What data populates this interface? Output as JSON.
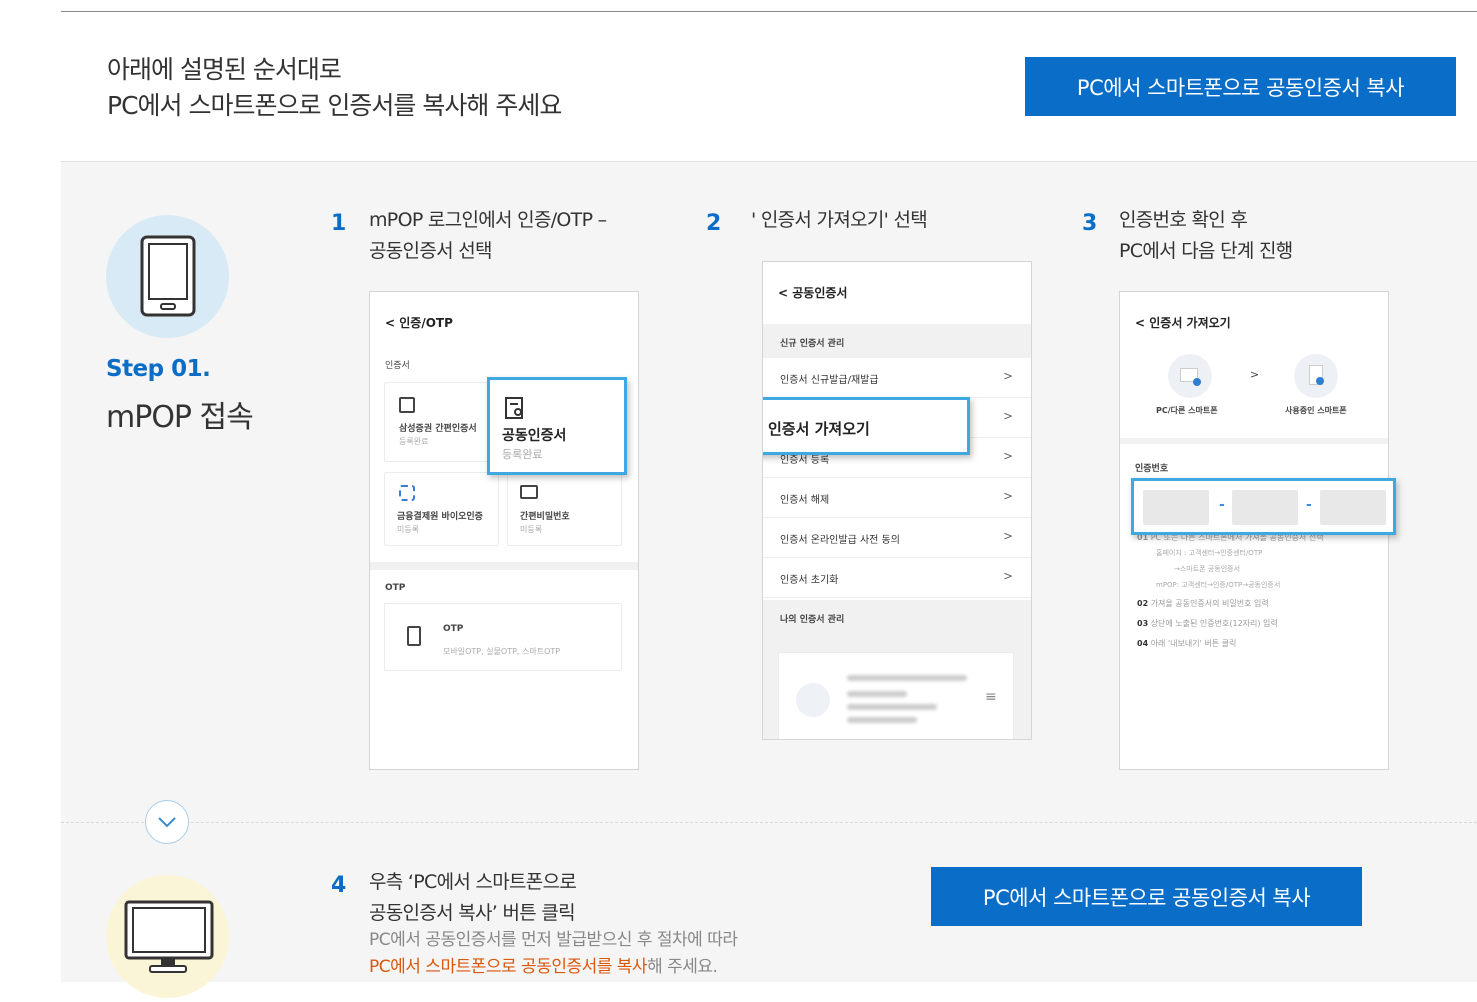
{
  "intro": {
    "line1": "아래에 설명된 순서대로",
    "line2": "PC에서 스마트폰으로 인증서를 복사해 주세요"
  },
  "top_button": "PC에서 스마트폰으로 공동인증서 복사",
  "step1": {
    "label": "Step 01.",
    "title": "mPOP 접속",
    "icon": "smartphone-icon",
    "items": [
      {
        "num": "1",
        "line1": "mPOP 로그인에서 인증/OTP –",
        "line2": "공동인증서 선택"
      },
      {
        "num": "2",
        "line1": "' 인증서 가져오기' 선택"
      },
      {
        "num": "3",
        "line1": "인증번호 확인 후",
        "line2": "PC에서 다음 단계 진행"
      }
    ]
  },
  "screen1": {
    "back": "< 인증/OTP",
    "section": "인증서",
    "card1_title": "삼성증권 간편인증서",
    "card1_sub": "등록완료",
    "popup_title": "공동인증서",
    "popup_sub": "등록완료",
    "card3_title": "금융결제원 바이오인증",
    "card3_sub": "미등록",
    "card4_title": "간편비밀번호",
    "card4_sub": "미등록",
    "otp_section": "OTP",
    "otp_title": "OTP",
    "otp_sub": "모바일OTP, 실물OTP, 스마트OTP"
  },
  "screen2": {
    "back": "< 공동인증서",
    "section1": "신규 인증서 관리",
    "rows": [
      "인증서 신규발급/재발급",
      "",
      "인증서 등록",
      "인증서 해제",
      "인증서 온라인발급 사전 동의",
      "인증서 초기화"
    ],
    "arrow": ">",
    "section2": "나의 인증서 관리",
    "popup": "인증서 가져오기"
  },
  "screen3": {
    "back": "< 인증서 가져오기",
    "from_label": "PC/다른 스마트폰",
    "to_label": "사용중인 스마트폰",
    "arrow": ">",
    "code_label": "인증번호",
    "dash": "-",
    "steps": [
      {
        "n": "01",
        "t": "PC 또는 다른 스마트폰에서 가져올 공동인증서 선택"
      },
      {
        "n": "",
        "t": "홈페이지 : 고객센터→인증센터/OTP"
      },
      {
        "n": "",
        "t": "→스마트폰 공동인증서"
      },
      {
        "n": "",
        "t": "mPOP: 고객센터→인증/OTP→공동인증서"
      },
      {
        "n": "02",
        "t": "가져올 공동인증서의 비밀번호 입력"
      },
      {
        "n": "03",
        "t": "상단에 노출된 인증번호(12자리) 입력"
      },
      {
        "n": "04",
        "t": "아래 '내보내기' 버튼 클릭"
      }
    ]
  },
  "step2": {
    "icon": "monitor-icon",
    "num": "4",
    "line1": "우측 ‘PC에서 스마트폰으로",
    "line2": "공동인증서 복사’ 버튼 클릭",
    "sub1": "PC에서 공동인증서를 먼저 발급받으신 후 절차에 따라",
    "sub2_hl": "PC에서 스마트폰으로 공동인증서를 복사",
    "sub2_rest": "해 주세요."
  },
  "bottom_button": "PC에서 스마트폰으로 공동인증서 복사",
  "colors": {
    "accent": "#0a6ec8",
    "highlight": "#d9580d",
    "popup_border": "#3fa8e0"
  }
}
